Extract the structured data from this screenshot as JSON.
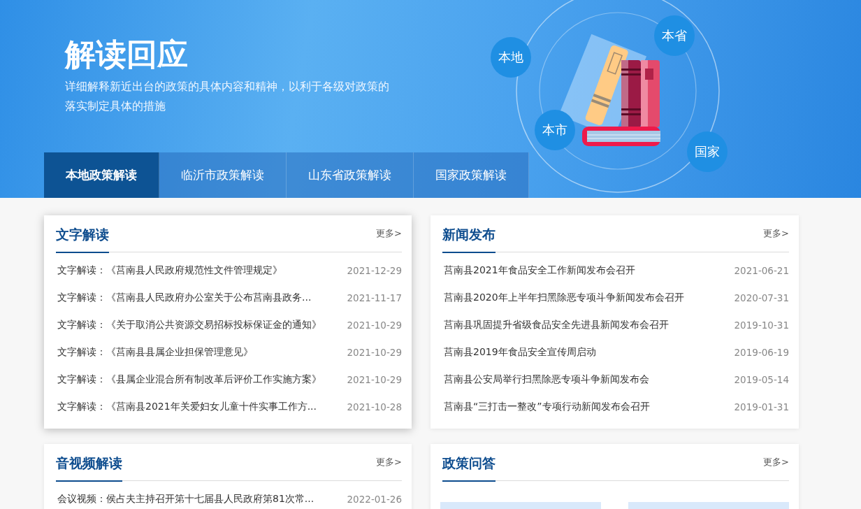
{
  "hero": {
    "title": "解读回应",
    "subtitle": "详细解释新近出台的政策的具体内容和精神，以利于各级对政策的落实制定具体的措施",
    "bubbles": [
      "本地",
      "本省",
      "本市",
      "国家"
    ]
  },
  "tabs": [
    {
      "label": "本地政策解读",
      "selected": true
    },
    {
      "label": "临沂市政策解读",
      "selected": false
    },
    {
      "label": "山东省政策解读",
      "selected": false
    },
    {
      "label": "国家政策解读",
      "selected": false
    }
  ],
  "panels": [
    {
      "kind": "list",
      "title": "文字解读",
      "more": "更多>",
      "raised": true,
      "items": [
        {
          "text": "文字解读：《莒南县人民政府规范性文件管理规定》",
          "date": "2021-12-29"
        },
        {
          "text": "文字解读：《莒南县人民政府办公室关于公布莒南县政务...",
          "date": "2021-11-17"
        },
        {
          "text": "文字解读：《关于取消公共资源交易招标投标保证金的通知》",
          "date": "2021-10-29"
        },
        {
          "text": "文字解读：《莒南县县属企业担保管理意见》",
          "date": "2021-10-29"
        },
        {
          "text": "文字解读：《县属企业混合所有制改革后评价工作实施方案》",
          "date": "2021-10-29"
        },
        {
          "text": "文字解读：《莒南县2021年关爱妇女儿童十件实事工作方...",
          "date": "2021-10-28"
        }
      ]
    },
    {
      "kind": "list",
      "title": "新闻发布",
      "more": "更多>",
      "raised": false,
      "items": [
        {
          "text": "莒南县2021年食品安全工作新闻发布会召开",
          "date": "2021-06-21"
        },
        {
          "text": "莒南县2020年上半年扫黑除恶专项斗争新闻发布会召开",
          "date": "2020-07-31"
        },
        {
          "text": "莒南县巩固提升省级食品安全先进县新闻发布会召开",
          "date": "2019-10-31"
        },
        {
          "text": "莒南县2019年食品安全宣传周启动",
          "date": "2019-06-19"
        },
        {
          "text": "莒南县公安局举行扫黑除恶专项斗争新闻发布会",
          "date": "2019-05-14"
        },
        {
          "text": "莒南县“三打击一整改”专项行动新闻发布会召开",
          "date": "2019-01-31"
        }
      ]
    },
    {
      "kind": "list",
      "title": "音视频解读",
      "more": "更多>",
      "raised": false,
      "items": [
        {
          "text": "会议视频：侯占夫主持召开第十七届县人民政府第81次常...",
          "date": "2022-01-26"
        }
      ]
    },
    {
      "kind": "images",
      "title": "政策问答",
      "more": "更多>",
      "raised": false
    }
  ]
}
